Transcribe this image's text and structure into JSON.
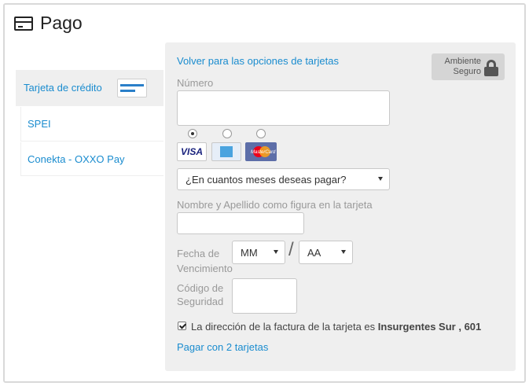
{
  "title": "Pago",
  "sidebar": {
    "items": [
      {
        "label": "Tarjeta de crédito"
      },
      {
        "label": "SPEI"
      },
      {
        "label": "Conekta - OXXO Pay"
      }
    ]
  },
  "panel": {
    "back_link": "Volver para las opciones de tarjetas",
    "secure_badge": [
      "Ambiente",
      "Seguro"
    ],
    "number_label": "Número",
    "number_value": "",
    "card_brands": [
      "VISA",
      "American Express",
      "MasterCard"
    ],
    "selected_brand": "VISA",
    "installments_select": "¿En cuantos meses deseas pagar?",
    "name_label": "Nombre y Apellido como figura en la tarjeta",
    "name_value": "",
    "expiry_label": [
      "Fecha de",
      "Vencimiento"
    ],
    "month_select": "MM",
    "year_select": "AA",
    "expiry_separator": "/",
    "cvv_label": [
      "Código de",
      "Seguridad"
    ],
    "cvv_value": "",
    "billing_checkbox_checked": true,
    "billing_text": "La dirección de la factura de la tarjeta es",
    "billing_address": "Insurgentes Sur , 601",
    "two_cards_link": "Pagar con 2 tarjetas"
  },
  "colors": {
    "link": "#1a8ccf",
    "panel_bg": "#efefef",
    "secure_bg": "#d5d5d5"
  }
}
